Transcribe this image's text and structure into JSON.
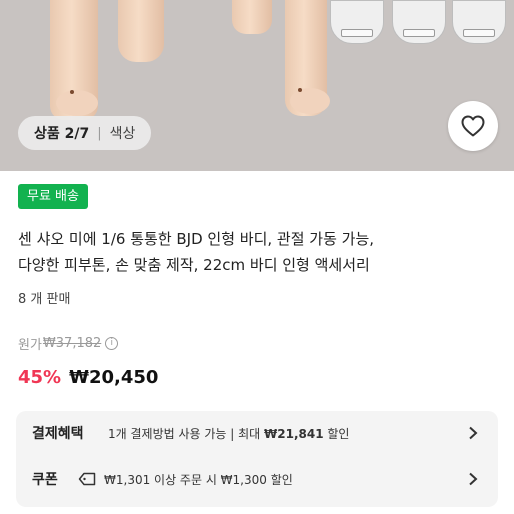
{
  "gallery": {
    "counter": "상품 2/7",
    "option_label": "색상"
  },
  "badge": "무료 배송",
  "product": {
    "title_line1": "센 샤오 미에 1/6 통통한 BJD 인형 바디, 관절 가동 가능,",
    "title_line2": "다양한 피부톤, 손 맞춤 제작, 22cm 바디 인형 액세서리",
    "sold": "8 개 판매"
  },
  "pricing": {
    "original_label": "원가",
    "original_price": "₩37,182",
    "discount": "45%",
    "price": "₩20,450"
  },
  "benefits": {
    "payment_title": "결제혜택",
    "payment_prefix": "1개 결제방법 사용 가능 | 최대 ",
    "payment_amount": "₩21,841",
    "payment_suffix": " 할인",
    "coupon_title": "쿠폰",
    "coupon_desc": "₩1,301 이상 주문 시 ₩1,300 할인"
  },
  "colors": {
    "badge_green": "#12b24f",
    "discount_red": "#f03654"
  }
}
